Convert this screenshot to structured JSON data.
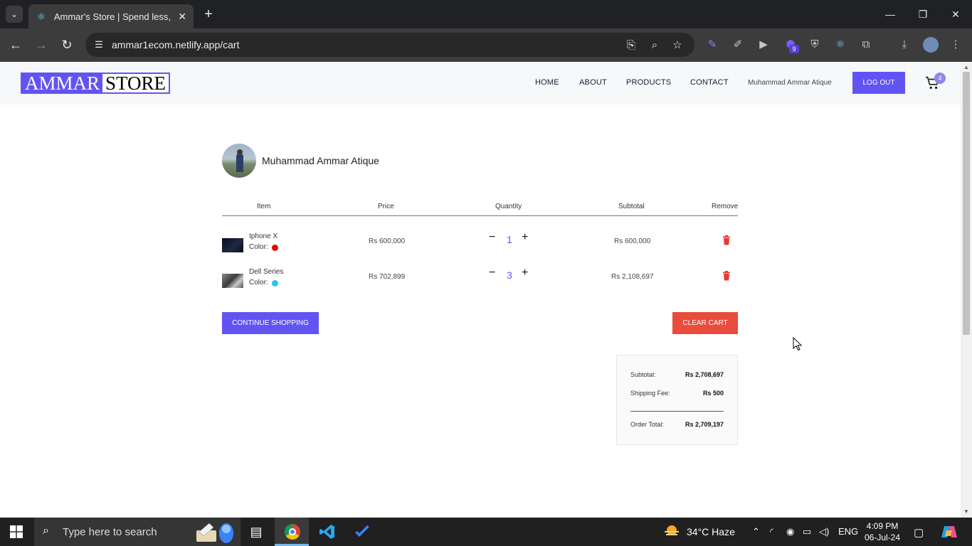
{
  "browser": {
    "tab_title": "Ammar's Store | Spend less, Sm",
    "url": "ammar1ecom.netlify.app/cart",
    "extension_badge": "9"
  },
  "header": {
    "logo_part1": "AMMAR",
    "logo_part2": "STORE",
    "nav": [
      "HOME",
      "ABOUT",
      "PRODUCTS",
      "CONTACT"
    ],
    "user_name": "Muhammad Ammar Atique",
    "logout_label": "LOG OUT",
    "cart_count": "4"
  },
  "profile": {
    "name": "Muhammad Ammar Atique"
  },
  "cart": {
    "columns": [
      "Item",
      "Price",
      "Quantity",
      "Subtotal",
      "Remove"
    ],
    "color_label": "Color:",
    "items": [
      {
        "name": "Iphone X",
        "color": "#e60000",
        "price": "Rs 600,000",
        "quantity": "1",
        "subtotal": "Rs 600,000"
      },
      {
        "name": "Dell Series",
        "color": "#22c8e6",
        "price": "Rs 702,899",
        "quantity": "3",
        "subtotal": "Rs 2,108,697"
      }
    ],
    "continue_label": "CONTINUE SHOPPING",
    "clear_label": "CLEAR CART"
  },
  "totals": {
    "subtotal_label": "Subtotal:",
    "subtotal_value": "Rs 2,708,697",
    "shipping_label": "Shipping Fee:",
    "shipping_value": "Rs 500",
    "order_label": "Order Total:",
    "order_value": "Rs 2,709,197"
  },
  "taskbar": {
    "search_placeholder": "Type here to search",
    "weather": "34°C  Haze",
    "language": "ENG",
    "time": "4:09 PM",
    "date": "06-Jul-24"
  },
  "colors": {
    "accent": "#6254f3",
    "danger": "#e74c3c"
  }
}
